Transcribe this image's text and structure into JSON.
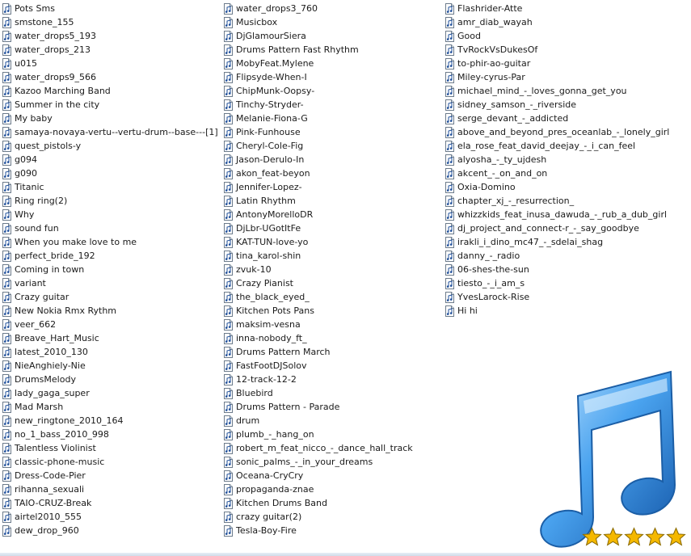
{
  "file_list": {
    "columns": [
      [
        "Pots Sms",
        "smstone_155",
        "water_drops5_193",
        "water_drops_213",
        "u015",
        "water_drops9_566",
        "Kazoo Marching Band",
        "Summer in the city",
        "My baby",
        "samaya-novaya-vertu--vertu-drum--base---[1]",
        "quest_pistols-y",
        "g094",
        "g090",
        "Titanic",
        "Ring ring(2)",
        "Why",
        "sound fun",
        "When you make love to me",
        "perfect_bride_192",
        "Coming in town",
        "variant",
        "Crazy guitar",
        "New Nokia Rmx Rythm",
        "veer_662",
        "Breave_Hart_Music",
        "latest_2010_130",
        "NieAnghiely-Nie",
        "DrumsMelody",
        "lady_gaga_super",
        "Mad Marsh",
        "new_ringtone_2010_164",
        "no_1_bass_2010_998",
        "Talentless Violinist",
        "classic-phone-music",
        "Dress-Code-Pier",
        "rihanna_sexuali",
        "TAIO-CRUZ-Break",
        "airtel2010_555",
        "dew_drop_960"
      ],
      [
        "water_drops3_760",
        "Musicbox",
        "DjGlamourSiera",
        "Drums Pattern Fast Rhythm",
        "MobyFeat.Mylene",
        "Flipsyde-When-I",
        "ChipMunk-Oopsy-",
        "Tinchy-Stryder-",
        "Melanie-Fiona-G",
        "Pink-Funhouse",
        "Cheryl-Cole-Fig",
        "Jason-Derulo-In",
        "akon_feat-beyon",
        "Jennifer-Lopez-",
        "Latin Rhythm",
        "AntonyMorelloDR",
        "DjLbr-UGotItFe",
        "KAT-TUN-love-yo",
        "tina_karol-shin",
        "zvuk-10",
        "Crazy Pianist",
        "the_black_eyed_",
        "Kitchen Pots Pans",
        "maksim-vesna",
        "inna-nobody_ft_",
        "Drums Pattern March",
        "FastFootDJSolov",
        "12-track-12-2",
        "Bluebird",
        "Drums Pattern - Parade",
        "drum",
        "plumb_-_hang_on",
        "robert_m_feat_nicco_-_dance_hall_track",
        "sonic_palms_-_in_your_dreams",
        "Oceana-CryCry",
        "propaganda-znae",
        "Kitchen Drums Band",
        "crazy guitar(2)",
        "Tesla-Boy-Fire"
      ],
      [
        "Flashrider-Atte",
        "amr_diab_wayah",
        "Good",
        "TvRockVsDukesOf",
        "to-phir-ao-guitar",
        "Miley-cyrus-Par",
        "michael_mind_-_loves_gonna_get_you",
        "sidney_samson_-_riverside",
        "serge_devant_-_addicted",
        "above_and_beyond_pres_oceanlab_-_lonely_girl",
        "ela_rose_feat_david_deejay_-_i_can_feel",
        "alyosha_-_ty_ujdesh",
        "akcent_-_on_and_on",
        "Oxia-Domino",
        "chapter_xj_-_resurrection_",
        "whizzkids_feat_inusa_dawuda_-_rub_a_dub_girl",
        "dj_project_and_connect-r_-_say_goodbye",
        "irakli_i_dino_mc47_-_sdelai_shag",
        "danny_-_radio",
        "06-shes-the-sun",
        "tiesto_-_i_am_s",
        "YvesLarock-Rise",
        "Hi hi"
      ]
    ]
  },
  "rating": {
    "value": 5,
    "max": 5
  },
  "icons": {
    "file": "audio-file-icon",
    "art": "music-note-icon",
    "star": "star-icon"
  },
  "colors": {
    "note_blue": "#2b7fd6",
    "star_gold": "#f5b800"
  }
}
